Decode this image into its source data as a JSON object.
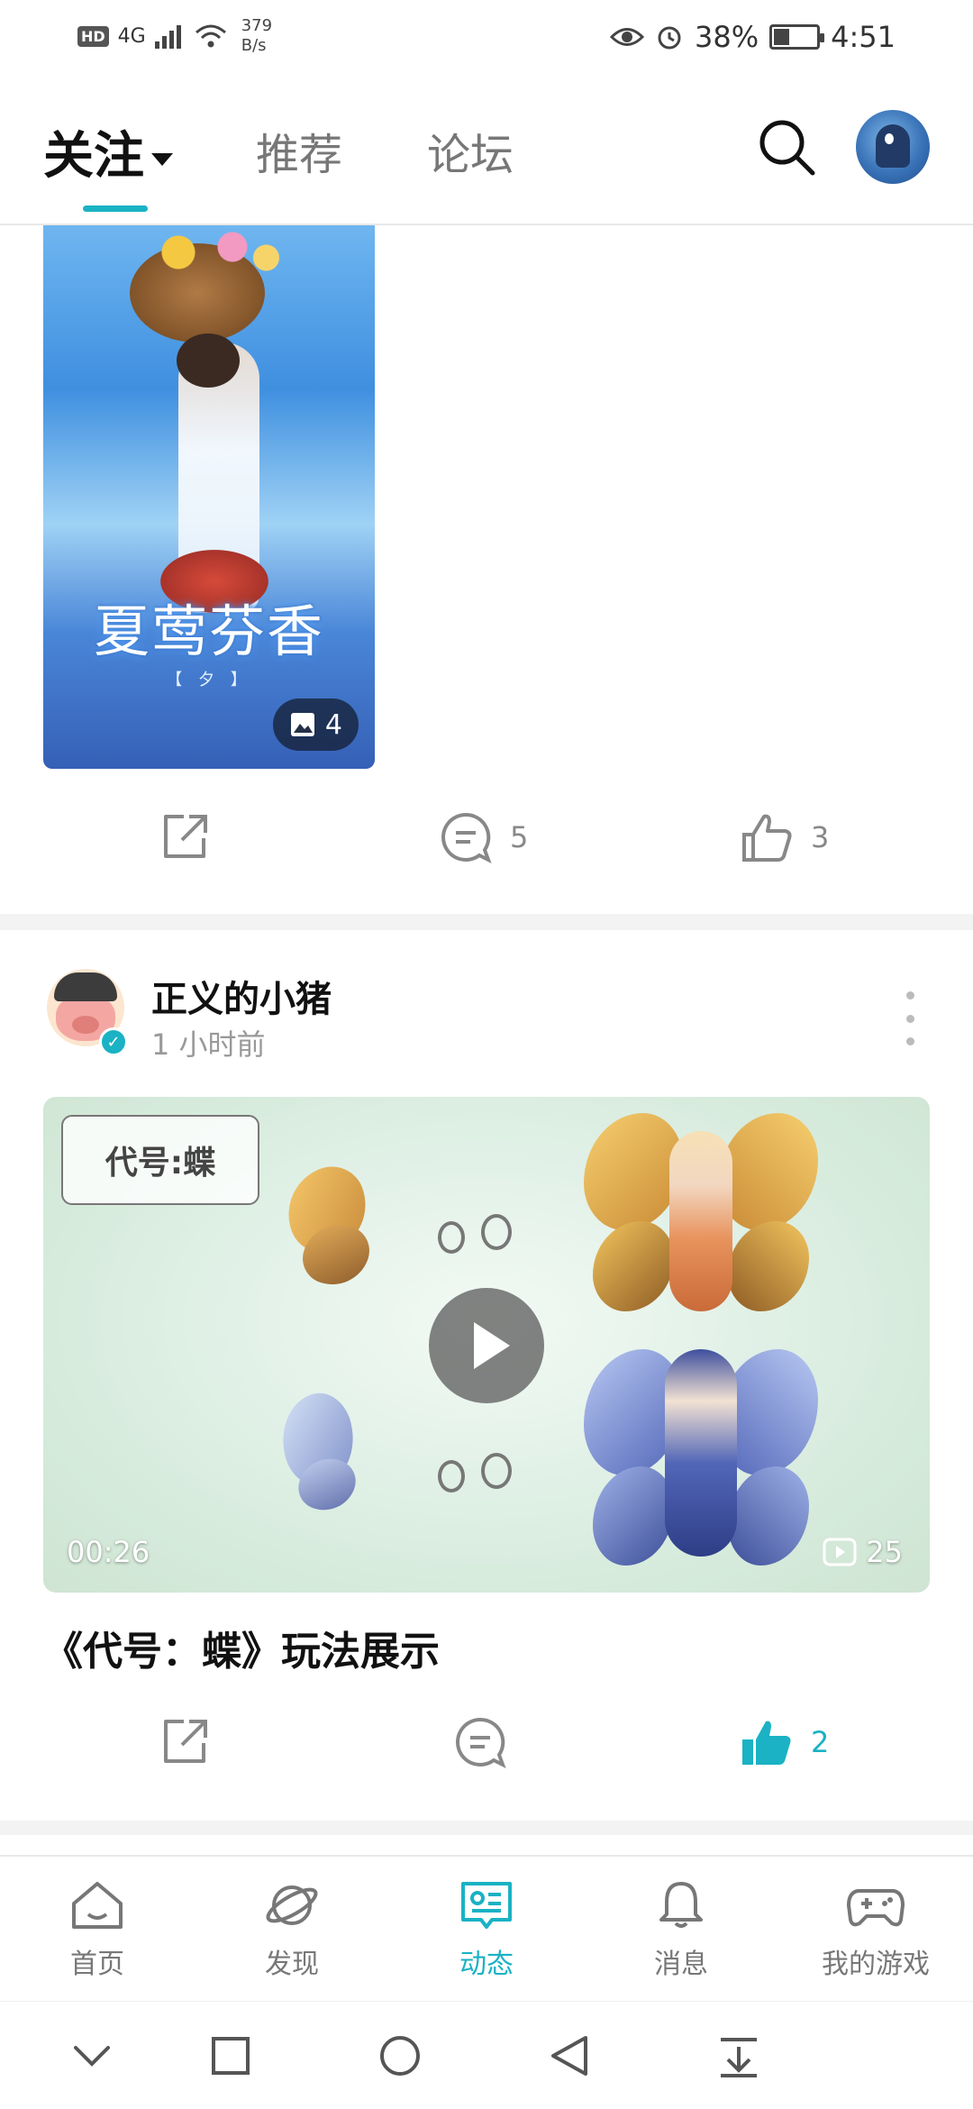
{
  "status_bar": {
    "hd": "HD",
    "network": "4G",
    "speed_value": "379",
    "speed_unit": "B/s",
    "battery": "38%",
    "battery_level": 0.38,
    "time": "4:51"
  },
  "top_nav": {
    "tabs": [
      {
        "label": "关注",
        "active": true
      },
      {
        "label": "推荐",
        "active": false
      },
      {
        "label": "论坛",
        "active": false
      }
    ],
    "accent_color": "#1ab2c4"
  },
  "post1": {
    "image_title": "夏莺芬香",
    "image_subtitle": "【 夕 】",
    "image_count": "4",
    "share_label": "",
    "comment_count": "5",
    "like_count": "3"
  },
  "post2": {
    "author": "正义的小猪",
    "time": "1 小时前",
    "video_tag": "代号:蝶",
    "video_duration": "00:26",
    "video_plays": "25",
    "title": "《代号：蝶》玩法展示",
    "comment_count": "",
    "like_count": "2",
    "liked": true
  },
  "bottom_nav": {
    "items": [
      {
        "label": "首页",
        "icon": "home-icon",
        "active": false
      },
      {
        "label": "发现",
        "icon": "planet-icon",
        "active": false
      },
      {
        "label": "动态",
        "icon": "feed-icon",
        "active": true
      },
      {
        "label": "消息",
        "icon": "bell-icon",
        "active": false
      },
      {
        "label": "我的游戏",
        "icon": "gamepad-icon",
        "active": false
      }
    ]
  },
  "system_nav": {
    "buttons": [
      "chevron-down-icon",
      "square-icon",
      "circle-icon",
      "back-icon",
      "download-icon"
    ]
  }
}
